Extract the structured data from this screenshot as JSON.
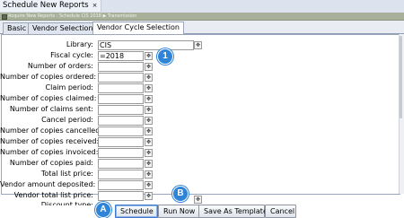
{
  "window": {
    "title": "Schedule New Reports",
    "close_glyph": "×"
  },
  "breadcrumb": {
    "text": "Acquire New Reports : Schedule CIS 2018 ▶ Transmission"
  },
  "tabs": [
    {
      "label": "Basic",
      "active": false
    },
    {
      "label": "Vendor Selection",
      "active": false
    },
    {
      "label": "Vendor Cycle Selection",
      "active": true
    }
  ],
  "form": {
    "rows": [
      {
        "label": "Library:",
        "value": "CIS"
      },
      {
        "label": "Fiscal cycle:",
        "value": "=2018"
      },
      {
        "label": "Number of orders:",
        "value": ""
      },
      {
        "label": "Number of copies ordered:",
        "value": ""
      },
      {
        "label": "Claim period:",
        "value": ""
      },
      {
        "label": "Number of copies claimed:",
        "value": ""
      },
      {
        "label": "Number of claims sent:",
        "value": ""
      },
      {
        "label": "Cancel period:",
        "value": ""
      },
      {
        "label": "Number of copies cancelled:",
        "value": ""
      },
      {
        "label": "Number of copies received:",
        "value": ""
      },
      {
        "label": "Number of copies invoiced:",
        "value": ""
      },
      {
        "label": "Number of copies paid:",
        "value": ""
      },
      {
        "label": "Total list price:",
        "value": ""
      },
      {
        "label": "Vendor amount deposited:",
        "value": ""
      },
      {
        "label": "Vendor total list price:",
        "value": ""
      },
      {
        "label": "Discount type:",
        "value": ""
      }
    ],
    "picker_glyph": "✥"
  },
  "buttons": {
    "schedule": "Schedule",
    "run_now": "Run Now",
    "save_template": "Save As Template",
    "cancel": "Cancel"
  },
  "callouts": {
    "one": "1",
    "a": "A",
    "b": "B"
  },
  "colors": {
    "callout": "#2f84d8",
    "crumb_bar": "#a8b09a"
  }
}
